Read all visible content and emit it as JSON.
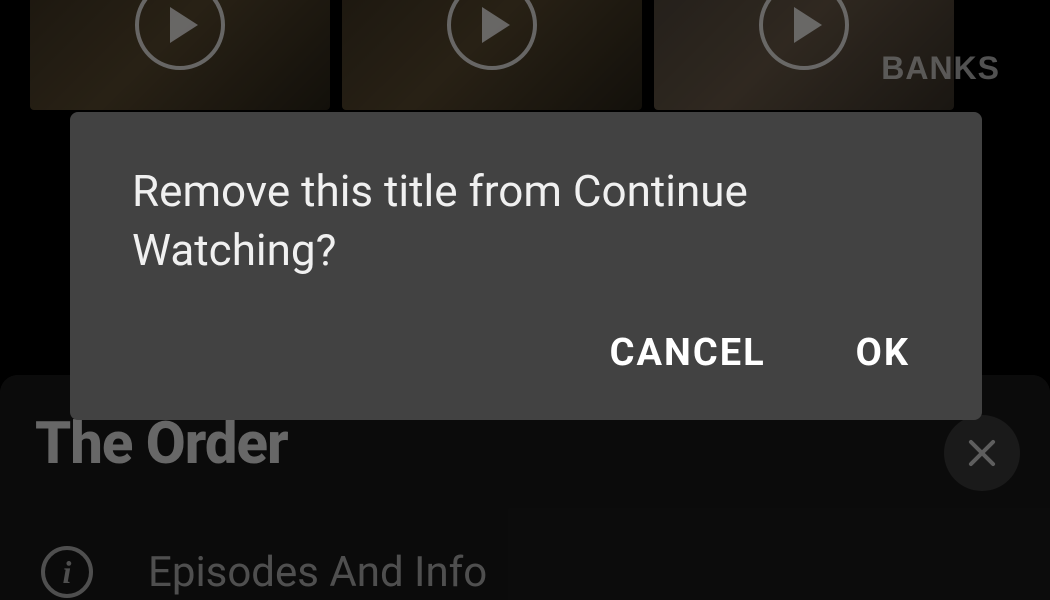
{
  "background": {
    "thumb_overlay_text": "BANKS"
  },
  "sheet": {
    "title": "The Order",
    "row1_label": "Episodes And Info"
  },
  "dialog": {
    "message": "Remove this title from Continue Watching?",
    "cancel_label": "CANCEL",
    "ok_label": "OK"
  }
}
